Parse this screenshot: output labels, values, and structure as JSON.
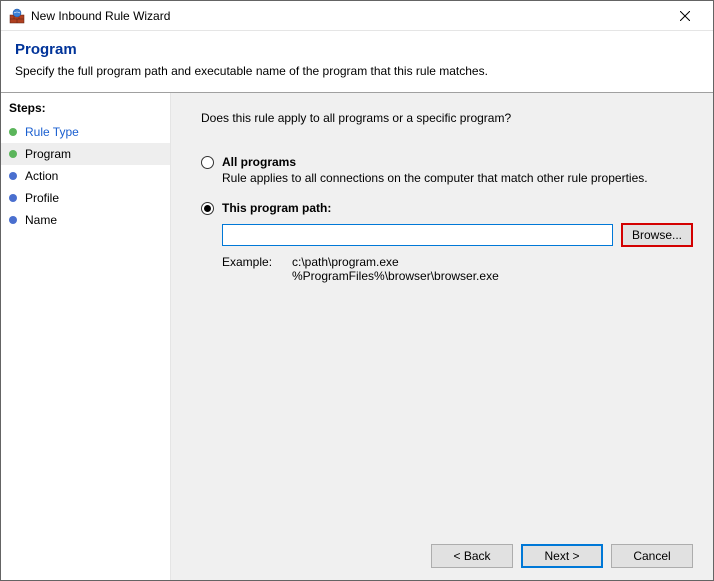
{
  "window": {
    "title": "New Inbound Rule Wizard"
  },
  "header": {
    "heading": "Program",
    "subtitle": "Specify the full program path and executable name of the program that this rule matches."
  },
  "sidebar": {
    "steps_label": "Steps:",
    "items": [
      {
        "label": "Rule Type"
      },
      {
        "label": "Program"
      },
      {
        "label": "Action"
      },
      {
        "label": "Profile"
      },
      {
        "label": "Name"
      }
    ]
  },
  "main": {
    "question": "Does this rule apply to all programs or a specific program?",
    "option_all": {
      "label": "All programs",
      "desc": "Rule applies to all connections on the computer that match other rule properties."
    },
    "option_path": {
      "label": "This program path:",
      "value": "",
      "browse": "Browse...",
      "example_label": "Example:",
      "example_text": "c:\\path\\program.exe\n%ProgramFiles%\\browser\\browser.exe"
    }
  },
  "buttons": {
    "back": "< Back",
    "next": "Next >",
    "cancel": "Cancel"
  }
}
